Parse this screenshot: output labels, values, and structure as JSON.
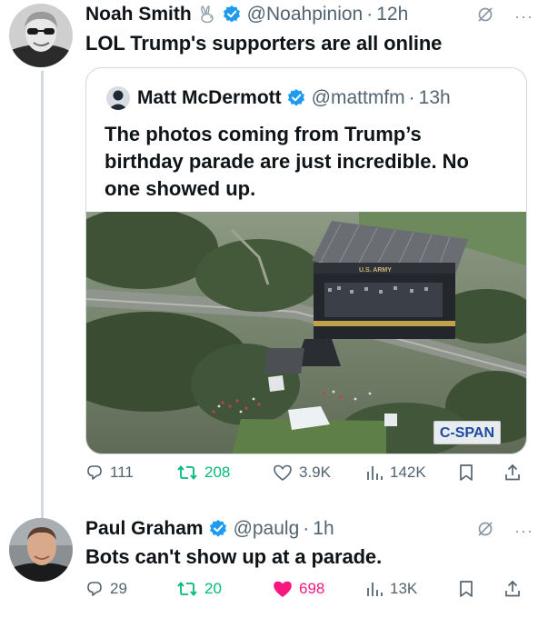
{
  "tweet1": {
    "author_name": "Noah Smith",
    "handle": "@Noahpinion",
    "separator": "·",
    "time": "12h",
    "text": "LOL Trump's supporters are all online",
    "icons": [
      "rabbit-icon",
      "verified-badge-icon",
      "mute-icon",
      "more-icon"
    ],
    "more_label": "···",
    "quoted": {
      "author_name": "Matt McDermott",
      "handle": "@mattmfm",
      "separator": "·",
      "time": "13h",
      "text_lines": [
        "The photos coming from Trump’s",
        "birthday parade are just incredible. No",
        "one showed up."
      ],
      "image_watermark": "C-SPAN",
      "stage_sign": "U.S. ARMY"
    },
    "stats": {
      "replies": "111",
      "reposts": "208",
      "likes": "3.9K",
      "views": "142K"
    }
  },
  "tweet2": {
    "author_name": "Paul Graham",
    "handle": "@paulg",
    "separator": "·",
    "time": "1h",
    "text": "Bots can't show up at a parade.",
    "more_label": "···",
    "stats": {
      "replies": "29",
      "reposts": "20",
      "likes": "698",
      "views": "13K"
    }
  },
  "colors": {
    "text_primary": "#0f1419",
    "text_secondary": "#536471",
    "verified_blue": "#1d9bf0",
    "repost_green": "#00ba7c",
    "like_pink": "#f91880",
    "border": "#cfd9de"
  }
}
